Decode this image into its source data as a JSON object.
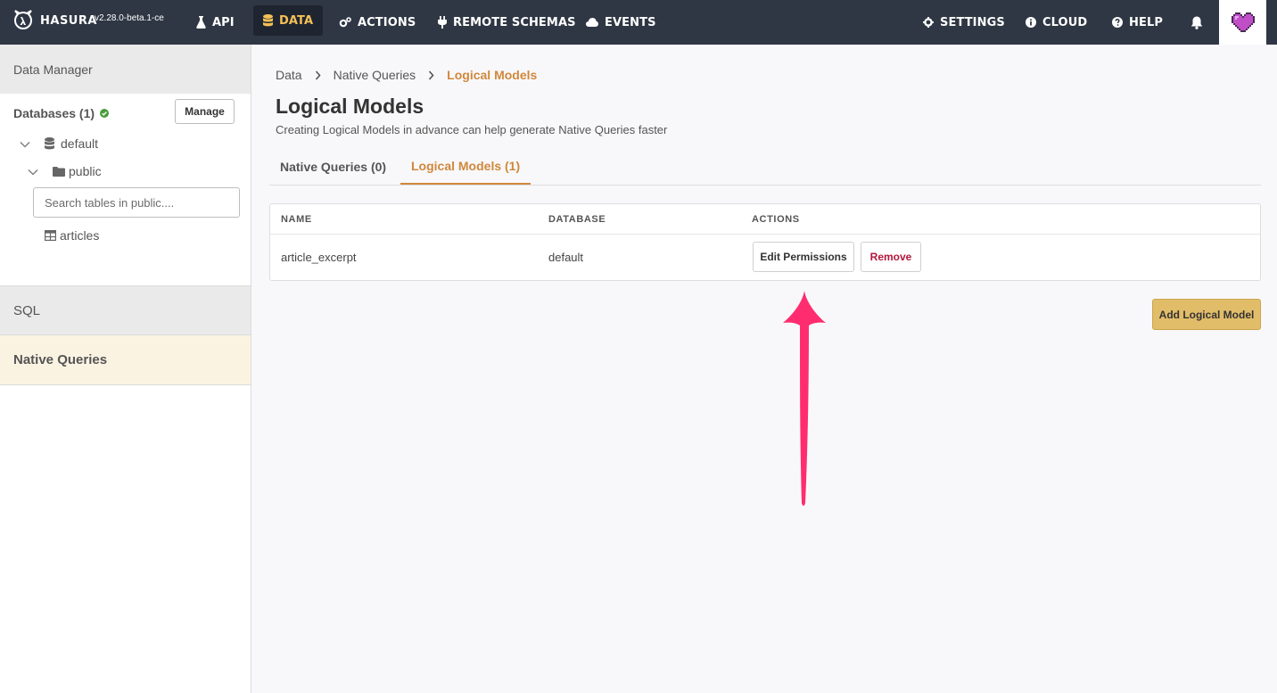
{
  "app": {
    "logo_text": "HASURA",
    "version": "v2.28.0-beta.1-ce"
  },
  "topnav": {
    "items": [
      {
        "label": "API",
        "icon": "flask-icon"
      },
      {
        "label": "DATA",
        "icon": "database-icon",
        "active": true
      },
      {
        "label": "ACTIONS",
        "icon": "cogs-icon"
      },
      {
        "label": "REMOTE SCHEMAS",
        "icon": "plug-icon"
      },
      {
        "label": "EVENTS",
        "icon": "cloud-icon"
      }
    ],
    "right_items": [
      {
        "label": "SETTINGS",
        "icon": "gear-icon"
      },
      {
        "label": "CLOUD",
        "icon": "info-icon"
      },
      {
        "label": "HELP",
        "icon": "question-icon"
      }
    ],
    "notifications_icon": "bell-icon",
    "avatar_icon": "pixel-heart-icon",
    "accent_color": "#f4c056"
  },
  "sidebar": {
    "header": "Data Manager",
    "databases_label": "Databases (1)",
    "manage_label": "Manage",
    "tree": {
      "database": "default",
      "schema": "public",
      "search_placeholder": "Search tables in public....",
      "tables": [
        "articles"
      ]
    },
    "sections": {
      "sql": "SQL",
      "native_queries": "Native Queries"
    }
  },
  "main": {
    "breadcrumb": [
      "Data",
      "Native Queries",
      "Logical Models"
    ],
    "title": "Logical Models",
    "subtitle": "Creating Logical Models in advance can help generate Native Queries faster",
    "tabs": [
      {
        "label": "Native Queries (0)",
        "active": false
      },
      {
        "label": "Logical Models (1)",
        "active": true
      }
    ],
    "table": {
      "headers": [
        "NAME",
        "DATABASE",
        "ACTIONS"
      ],
      "rows": [
        {
          "name": "article_excerpt",
          "database": "default"
        }
      ],
      "edit_label": "Edit Permissions",
      "remove_label": "Remove"
    },
    "add_button": "Add Logical Model",
    "brand_color": "#d0883c",
    "annotation_color": "#ff2d6f"
  }
}
